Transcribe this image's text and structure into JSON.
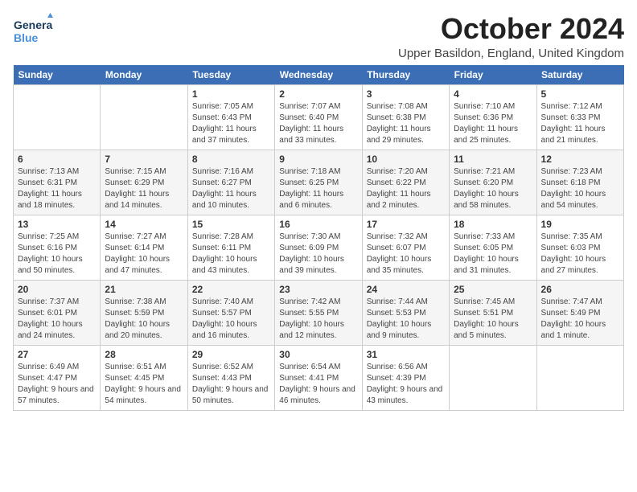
{
  "logo": {
    "line1": "General",
    "line2": "Blue"
  },
  "title": "October 2024",
  "subtitle": "Upper Basildon, England, United Kingdom",
  "days_of_week": [
    "Sunday",
    "Monday",
    "Tuesday",
    "Wednesday",
    "Thursday",
    "Friday",
    "Saturday"
  ],
  "weeks": [
    [
      {
        "day": "",
        "detail": ""
      },
      {
        "day": "",
        "detail": ""
      },
      {
        "day": "1",
        "detail": "Sunrise: 7:05 AM\nSunset: 6:43 PM\nDaylight: 11 hours and 37 minutes."
      },
      {
        "day": "2",
        "detail": "Sunrise: 7:07 AM\nSunset: 6:40 PM\nDaylight: 11 hours and 33 minutes."
      },
      {
        "day": "3",
        "detail": "Sunrise: 7:08 AM\nSunset: 6:38 PM\nDaylight: 11 hours and 29 minutes."
      },
      {
        "day": "4",
        "detail": "Sunrise: 7:10 AM\nSunset: 6:36 PM\nDaylight: 11 hours and 25 minutes."
      },
      {
        "day": "5",
        "detail": "Sunrise: 7:12 AM\nSunset: 6:33 PM\nDaylight: 11 hours and 21 minutes."
      }
    ],
    [
      {
        "day": "6",
        "detail": "Sunrise: 7:13 AM\nSunset: 6:31 PM\nDaylight: 11 hours and 18 minutes."
      },
      {
        "day": "7",
        "detail": "Sunrise: 7:15 AM\nSunset: 6:29 PM\nDaylight: 11 hours and 14 minutes."
      },
      {
        "day": "8",
        "detail": "Sunrise: 7:16 AM\nSunset: 6:27 PM\nDaylight: 11 hours and 10 minutes."
      },
      {
        "day": "9",
        "detail": "Sunrise: 7:18 AM\nSunset: 6:25 PM\nDaylight: 11 hours and 6 minutes."
      },
      {
        "day": "10",
        "detail": "Sunrise: 7:20 AM\nSunset: 6:22 PM\nDaylight: 11 hours and 2 minutes."
      },
      {
        "day": "11",
        "detail": "Sunrise: 7:21 AM\nSunset: 6:20 PM\nDaylight: 10 hours and 58 minutes."
      },
      {
        "day": "12",
        "detail": "Sunrise: 7:23 AM\nSunset: 6:18 PM\nDaylight: 10 hours and 54 minutes."
      }
    ],
    [
      {
        "day": "13",
        "detail": "Sunrise: 7:25 AM\nSunset: 6:16 PM\nDaylight: 10 hours and 50 minutes."
      },
      {
        "day": "14",
        "detail": "Sunrise: 7:27 AM\nSunset: 6:14 PM\nDaylight: 10 hours and 47 minutes."
      },
      {
        "day": "15",
        "detail": "Sunrise: 7:28 AM\nSunset: 6:11 PM\nDaylight: 10 hours and 43 minutes."
      },
      {
        "day": "16",
        "detail": "Sunrise: 7:30 AM\nSunset: 6:09 PM\nDaylight: 10 hours and 39 minutes."
      },
      {
        "day": "17",
        "detail": "Sunrise: 7:32 AM\nSunset: 6:07 PM\nDaylight: 10 hours and 35 minutes."
      },
      {
        "day": "18",
        "detail": "Sunrise: 7:33 AM\nSunset: 6:05 PM\nDaylight: 10 hours and 31 minutes."
      },
      {
        "day": "19",
        "detail": "Sunrise: 7:35 AM\nSunset: 6:03 PM\nDaylight: 10 hours and 27 minutes."
      }
    ],
    [
      {
        "day": "20",
        "detail": "Sunrise: 7:37 AM\nSunset: 6:01 PM\nDaylight: 10 hours and 24 minutes."
      },
      {
        "day": "21",
        "detail": "Sunrise: 7:38 AM\nSunset: 5:59 PM\nDaylight: 10 hours and 20 minutes."
      },
      {
        "day": "22",
        "detail": "Sunrise: 7:40 AM\nSunset: 5:57 PM\nDaylight: 10 hours and 16 minutes."
      },
      {
        "day": "23",
        "detail": "Sunrise: 7:42 AM\nSunset: 5:55 PM\nDaylight: 10 hours and 12 minutes."
      },
      {
        "day": "24",
        "detail": "Sunrise: 7:44 AM\nSunset: 5:53 PM\nDaylight: 10 hours and 9 minutes."
      },
      {
        "day": "25",
        "detail": "Sunrise: 7:45 AM\nSunset: 5:51 PM\nDaylight: 10 hours and 5 minutes."
      },
      {
        "day": "26",
        "detail": "Sunrise: 7:47 AM\nSunset: 5:49 PM\nDaylight: 10 hours and 1 minute."
      }
    ],
    [
      {
        "day": "27",
        "detail": "Sunrise: 6:49 AM\nSunset: 4:47 PM\nDaylight: 9 hours and 57 minutes."
      },
      {
        "day": "28",
        "detail": "Sunrise: 6:51 AM\nSunset: 4:45 PM\nDaylight: 9 hours and 54 minutes."
      },
      {
        "day": "29",
        "detail": "Sunrise: 6:52 AM\nSunset: 4:43 PM\nDaylight: 9 hours and 50 minutes."
      },
      {
        "day": "30",
        "detail": "Sunrise: 6:54 AM\nSunset: 4:41 PM\nDaylight: 9 hours and 46 minutes."
      },
      {
        "day": "31",
        "detail": "Sunrise: 6:56 AM\nSunset: 4:39 PM\nDaylight: 9 hours and 43 minutes."
      },
      {
        "day": "",
        "detail": ""
      },
      {
        "day": "",
        "detail": ""
      }
    ]
  ]
}
